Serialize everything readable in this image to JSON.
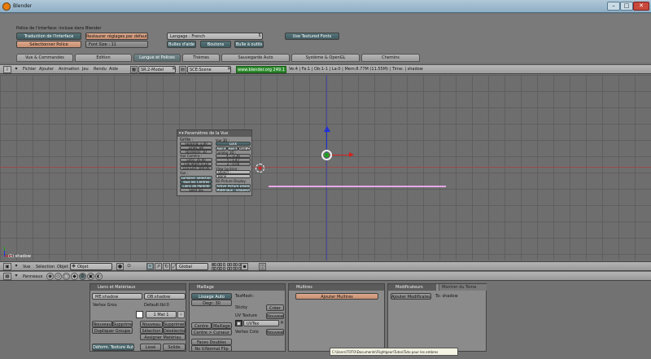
{
  "window": {
    "title": "Blender"
  },
  "prefs": {
    "section_label": "Police de l'interface: incluse dans Blender",
    "translate_btn": "Traduction de l'interface",
    "select_font_btn": "Sélectionner Police",
    "restore_btn": "Restaurer réglages par défaut",
    "font_size": "Font Size : 11",
    "language": "Langage : French",
    "tooltips_btn": "Bulles d'aide",
    "buttons_btn": "Boutons",
    "tool_tips_btn": "Bulle à outils",
    "textured_fonts_btn": "Use Textured Fonts"
  },
  "tabs": [
    "Vue & Commandes",
    "Edition",
    "Langue et Polices",
    "Thèmes",
    "Sauvegarde Auto",
    "Système & OpenGL",
    "Chemins"
  ],
  "menubar": {
    "items": [
      "Fichier",
      "Ajouter",
      "Animation",
      "Jeu",
      "Rendu",
      "Aide"
    ],
    "screen": "SR:2-Model",
    "scene": "SCE:Scene",
    "url": "www.blender.org 249.1",
    "stats": "Ve:4 | Fa:1 | Ob:1-1 | La:0 | Mem:8.77M (11.55M) | Time: | shadow"
  },
  "view_props": {
    "title": "Paramètres de la Vue",
    "grid_label": "Grille :",
    "spacing": "Spacing: 1.00",
    "lines": "Lines: 80",
    "divisions": "Divisions: 10",
    "camera_label": "Vue Caméra :",
    "lens": "Lens: 35.00",
    "clip_start": "Clip Start: 0.10",
    "clip_end": "Clip End: 500.00",
    "misc_label": "Vue :",
    "sel_outline": "Surligner Sélection",
    "all_centers": "Tous les Centres",
    "rel_lines": "Liens de Parenté",
    "solid_tex": "Solid Tex",
    "view3d_label": "Vue 3D :",
    "lock": "Lock",
    "axis": [
      "Axe X",
      "Axe Y",
      "Axe Z"
    ],
    "cursor_label": "Curseur 3D :",
    "cx": "X : -2.36",
    "cy": "Y : 1.47",
    "cz": "Z : 0.00",
    "lock_label": "View Locking :",
    "object": "Object :",
    "bone": "Bone",
    "bg_label": "BG Picture Display",
    "bg_btn": "Active Picture Display",
    "transp_btn": "Matériaux : Shapes/key"
  },
  "viewport": {
    "object_label": "(1) shadow"
  },
  "header3d": {
    "view": "Vue",
    "select": "Sélection",
    "object": "Objet",
    "mode": "Objet",
    "orientation": "Global"
  },
  "buttons_header": {
    "label": "Panneaux"
  },
  "panels": {
    "links": {
      "title": "Liens et Matériaux",
      "mesh": "ME:shadow",
      "obj": "OB:shadow",
      "vgroup": "Vertex Grou",
      "defbu": "Default:lbl:0",
      "mat": "1 Mat 1",
      "new": "Nouveau",
      "delete": "Supprimer",
      "copy_group": "Dupliquer Groupe",
      "mat_new": "Nouveau",
      "mat_delete": "Supprimer",
      "select": "Sélection",
      "deselect": "Désélection",
      "assign": "Assigner Matériau",
      "autotex": "Déform. Texture Auto",
      "smooth": "Lissé",
      "solid": "Solide"
    },
    "mesh": {
      "title": "Maillage",
      "autosmooth": "Lissage Auto",
      "degr": "Degr: 30",
      "texmesh": "TexMesh:",
      "sticky": "Sticky",
      "create": "Créer",
      "uvtex": "UV Texture",
      "new": "Nouveau",
      "uvtex_name": "UVTex",
      "vcol": "Vertex Colo",
      "new2": "Nouveau",
      "center": "Centre",
      "center_new": "Maillage",
      "center_cursor": "Centre > Curseur",
      "double": "Faces Doubles",
      "no_vnormal": "No V.Normal Flip"
    },
    "multires": {
      "title": "Multires",
      "add": "Ajouter Multires"
    },
    "modifiers": {
      "title": "Modificateurs",
      "tab2": "Montrer du Tome",
      "add": "Ajouter Modificateur",
      "to": "To: shadow"
    }
  },
  "tooltip": {
    "text": "C:\\Users\\TOTO\\Documents\\Flightgear\\Tutos\\Tuto pour les ombres"
  },
  "colors": {
    "accent": "#5a6d70",
    "salmon": "#d49c80",
    "axis_x": "#d12020",
    "axis_y": "#2030d8",
    "axis_z": "#20a020"
  }
}
